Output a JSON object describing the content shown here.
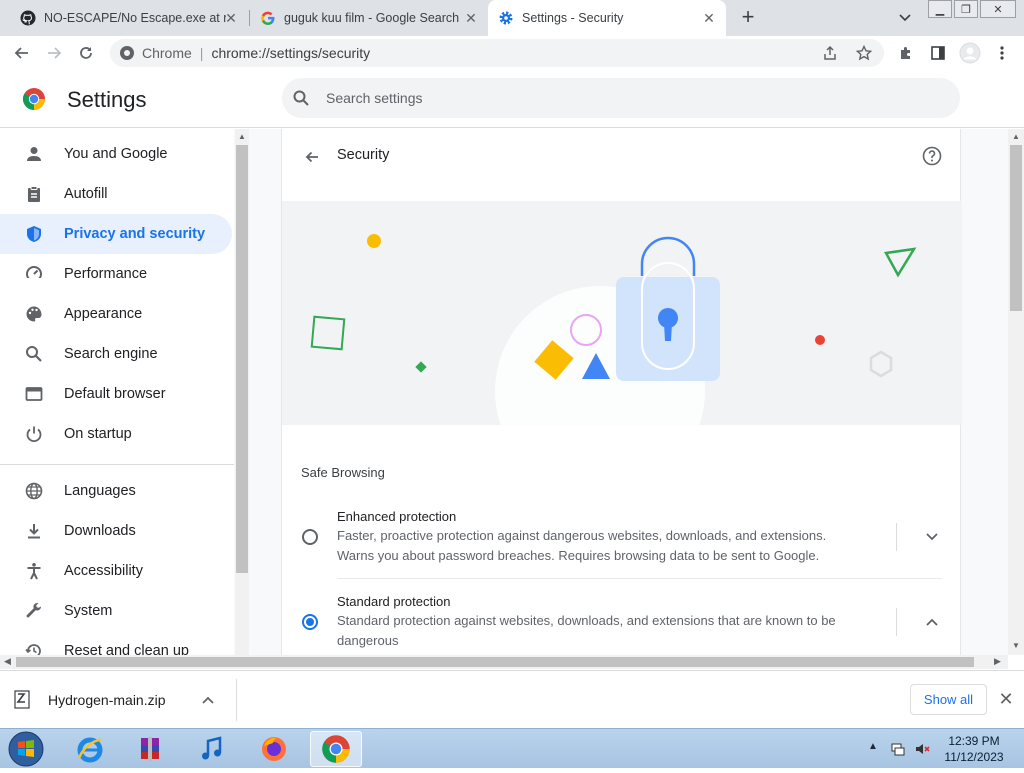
{
  "tabs": [
    {
      "title": "NO-ESCAPE/No Escape.exe at m",
      "icon": "github-icon"
    },
    {
      "title": "guguk kuu film - Google Search",
      "icon": "google-icon"
    },
    {
      "title": "Settings - Security",
      "icon": "settings-gear-icon",
      "active": true
    }
  ],
  "omnibox": {
    "site": "Chrome",
    "url": "chrome://settings/security"
  },
  "header": {
    "title": "Settings",
    "search_placeholder": "Search settings"
  },
  "sidebar": {
    "items": [
      {
        "label": "You and Google",
        "icon": "person-icon"
      },
      {
        "label": "Autofill",
        "icon": "clipboard-icon"
      },
      {
        "label": "Privacy and security",
        "icon": "shield-icon",
        "active": true
      },
      {
        "label": "Performance",
        "icon": "speedometer-icon"
      },
      {
        "label": "Appearance",
        "icon": "palette-icon"
      },
      {
        "label": "Search engine",
        "icon": "search-icon"
      },
      {
        "label": "Default browser",
        "icon": "browser-icon"
      },
      {
        "label": "On startup",
        "icon": "power-icon"
      },
      {
        "label": "Languages",
        "icon": "globe-icon"
      },
      {
        "label": "Downloads",
        "icon": "download-icon"
      },
      {
        "label": "Accessibility",
        "icon": "accessibility-icon"
      },
      {
        "label": "System",
        "icon": "wrench-icon"
      },
      {
        "label": "Reset and clean up",
        "icon": "history-icon"
      }
    ]
  },
  "security": {
    "title": "Security",
    "safe_browsing_label": "Safe Browsing",
    "options": [
      {
        "title": "Enhanced protection",
        "description": "Faster, proactive protection against dangerous websites, downloads, and extensions. Warns you about password breaches. Requires browsing data to be sent to Google.",
        "selected": false,
        "expanded": false
      },
      {
        "title": "Standard protection",
        "description": "Standard protection against websites, downloads, and extensions that are known to be dangerous",
        "selected": true,
        "expanded": true
      }
    ]
  },
  "downloads": {
    "file": "Hydrogen-main.zip",
    "show_all": "Show all"
  },
  "taskbar": {
    "time": "12:39 PM",
    "date": "11/12/2023"
  },
  "colors": {
    "accent": "#1a73e8",
    "active_bg": "#e8f0fe",
    "tabstrip": "#dee1e6"
  }
}
